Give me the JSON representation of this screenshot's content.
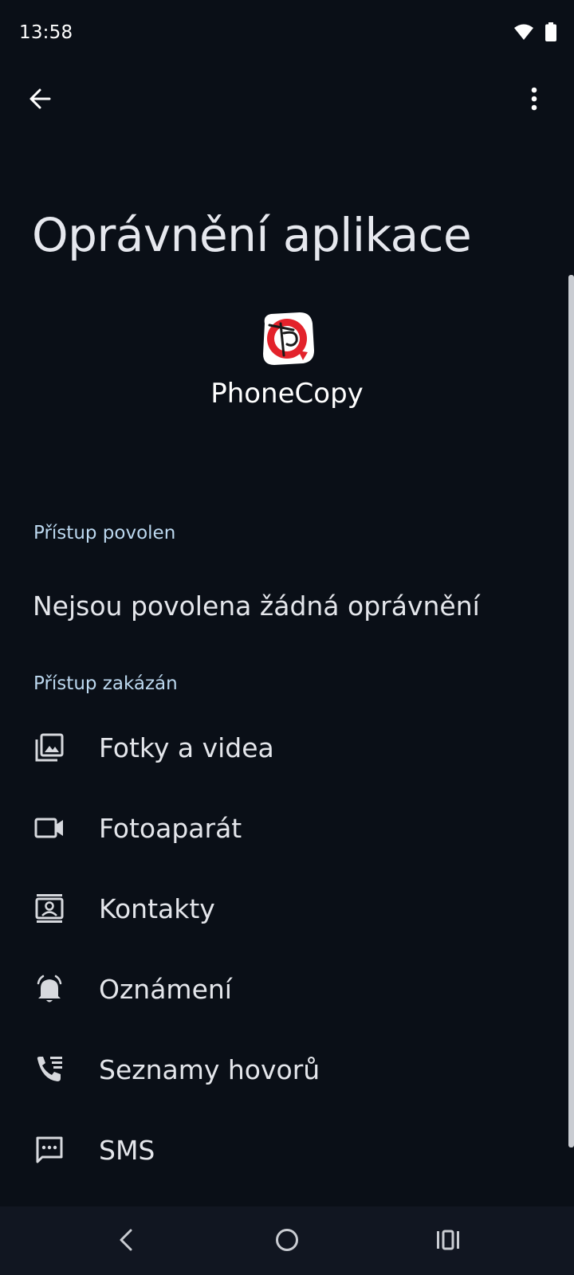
{
  "status_bar": {
    "time": "13:58",
    "icons": [
      "wifi-icon",
      "battery-icon"
    ]
  },
  "toolbar": {
    "back_icon": "arrow-left-icon",
    "more_icon": "more-vertical-icon"
  },
  "page": {
    "title": "Oprávnění aplikace"
  },
  "app": {
    "name": "PhoneCopy",
    "icon": "phonecopy-logo"
  },
  "allowed_section": {
    "label": "Přístup povolen",
    "empty_text": "Nejsou povolena žádná oprávnění"
  },
  "denied_section": {
    "label": "Přístup zakázán",
    "items": [
      {
        "label": "Fotky a videa",
        "icon": "photo-library-icon"
      },
      {
        "label": "Fotoaparát",
        "icon": "videocam-icon"
      },
      {
        "label": "Kontakty",
        "icon": "contacts-icon"
      },
      {
        "label": "Oznámení",
        "icon": "notification-bell-icon"
      },
      {
        "label": "Seznamy hovorů",
        "icon": "call-log-icon"
      },
      {
        "label": "SMS",
        "icon": "sms-icon"
      }
    ]
  },
  "nav_bar": {
    "buttons": [
      "nav-back-icon",
      "nav-home-icon",
      "nav-recents-icon"
    ]
  },
  "colors": {
    "background": "#0a0f17",
    "section_label": "#bcd8ef",
    "text": "#e4e6eb",
    "nav_bar": "#111621"
  }
}
